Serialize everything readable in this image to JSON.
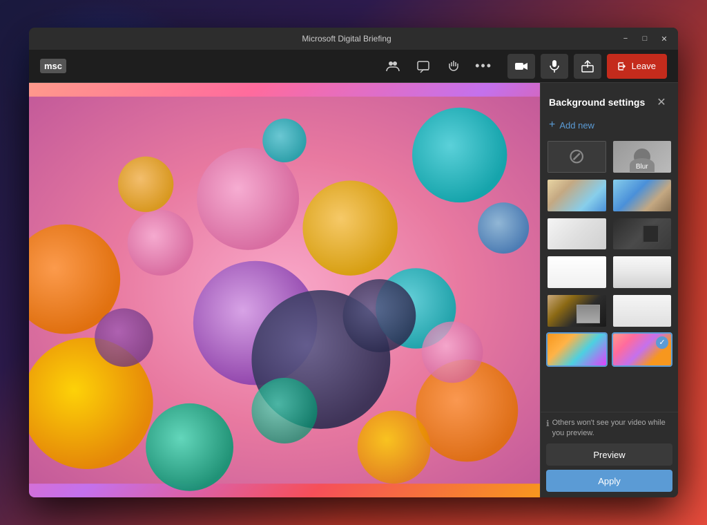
{
  "window": {
    "title": "Microsoft Digital Briefing",
    "controls": {
      "minimize": "−",
      "maximize": "□",
      "close": "✕"
    }
  },
  "toolbar": {
    "logo": "msc",
    "icons": [
      {
        "name": "people-icon",
        "symbol": "👥"
      },
      {
        "name": "chat-icon",
        "symbol": "💬"
      },
      {
        "name": "hand-icon",
        "symbol": "✋"
      },
      {
        "name": "more-icon",
        "symbol": "•••"
      }
    ],
    "camera_label": "📷",
    "mic_label": "🎤",
    "share_label": "⬆",
    "leave_label": "Leave"
  },
  "background_settings": {
    "title": "Background settings",
    "add_new_label": "Add new",
    "info_text": "Others won't see your video while you preview.",
    "preview_label": "Preview",
    "apply_label": "Apply",
    "thumbnails": [
      {
        "id": "none",
        "type": "none",
        "label": ""
      },
      {
        "id": "blur",
        "type": "blur",
        "label": "Blur"
      },
      {
        "id": "room1",
        "type": "room",
        "class": "room-1"
      },
      {
        "id": "room2",
        "type": "room",
        "class": "room-2"
      },
      {
        "id": "room3",
        "type": "room",
        "class": "room-3"
      },
      {
        "id": "room4",
        "type": "room",
        "class": "room-4"
      },
      {
        "id": "room5",
        "type": "room",
        "class": "room-5"
      },
      {
        "id": "room6",
        "type": "room",
        "class": "room-6"
      },
      {
        "id": "room7",
        "type": "room",
        "class": "room-7"
      },
      {
        "id": "room8",
        "type": "room",
        "class": "room-8"
      },
      {
        "id": "room9",
        "type": "room",
        "class": "room-9"
      },
      {
        "id": "room10",
        "type": "room",
        "class": "room-10",
        "selected": true
      }
    ]
  },
  "colors": {
    "leave_btn": "#c42b1c",
    "apply_btn": "#5b9bd5",
    "accent": "#5b9bd5"
  }
}
